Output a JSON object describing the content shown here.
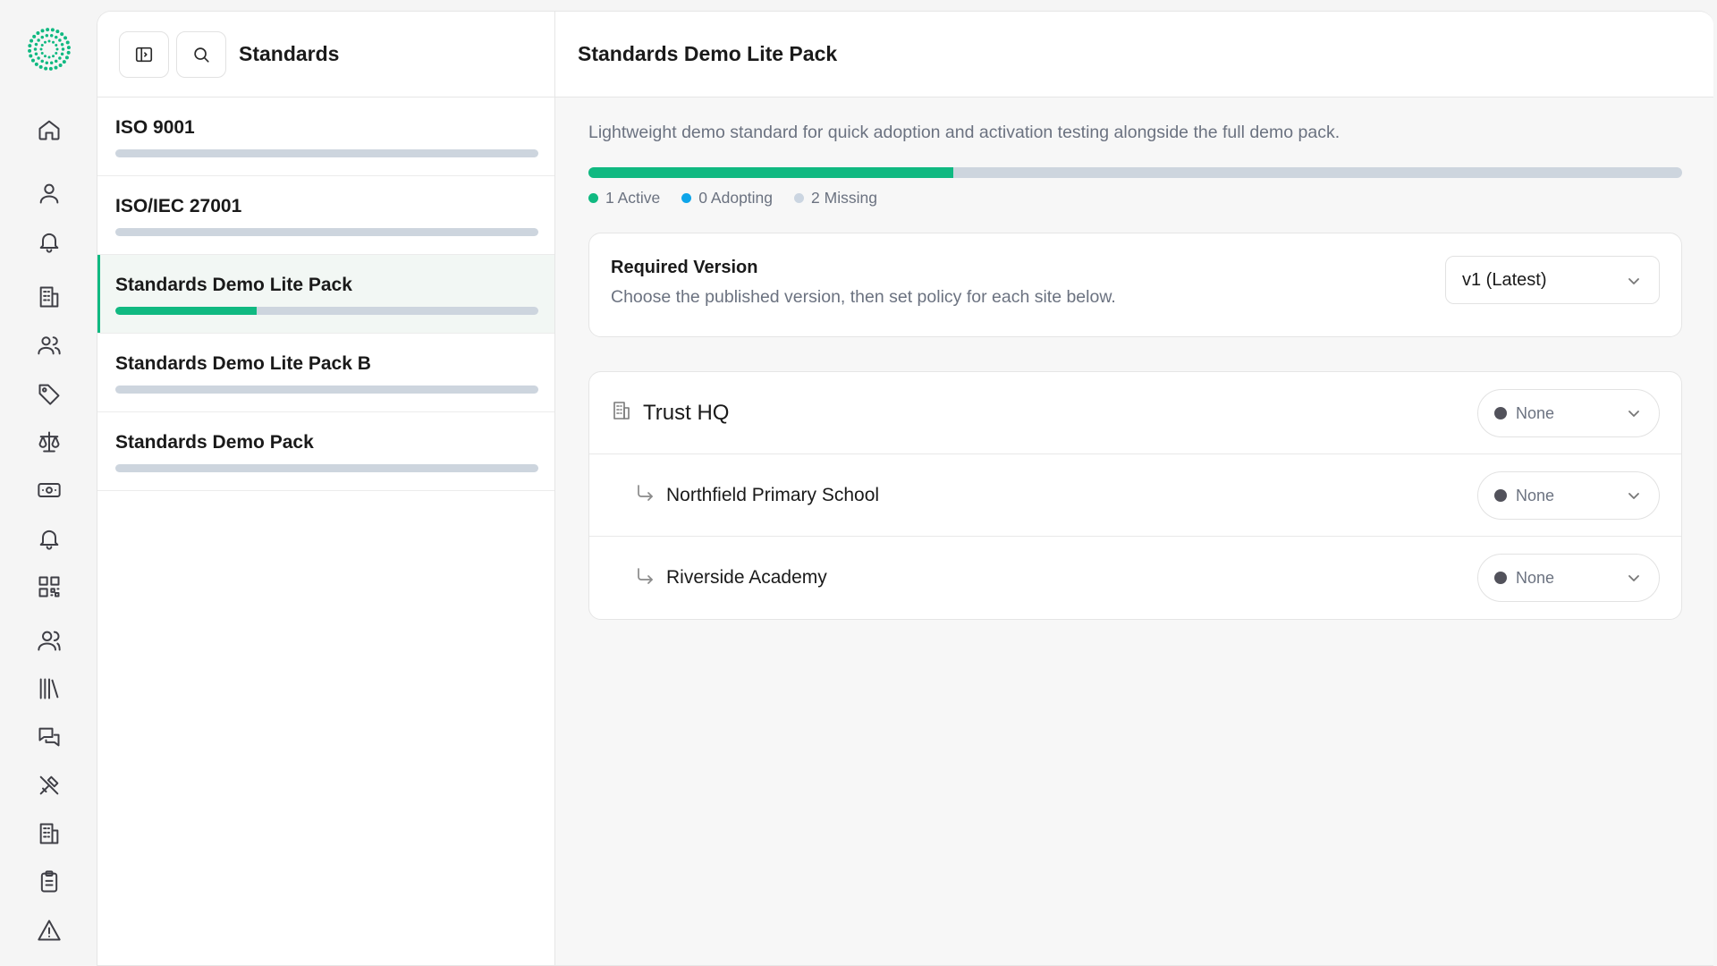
{
  "colors": {
    "accent": "#10b981",
    "adopting": "#0ea5e9",
    "missing": "#cbd5e1",
    "none_dot": "#52525b"
  },
  "rail": {
    "icons": [
      "home-icon",
      "user-icon",
      "bell-icon",
      "building-icon",
      "users-icon",
      "tag-icon",
      "scale-icon",
      "money-icon",
      "bell-icon",
      "qr-code-icon",
      "people-icon",
      "library-icon",
      "messages-icon",
      "tools-icon",
      "building-icon",
      "clipboard-icon",
      "warning-icon"
    ]
  },
  "list": {
    "title": "Standards",
    "items": [
      {
        "name": "ISO 9001",
        "progress": 0
      },
      {
        "name": "ISO/IEC 27001",
        "progress": 0
      },
      {
        "name": "Standards Demo Lite Pack",
        "progress": 0.333,
        "active": true
      },
      {
        "name": "Standards Demo Lite Pack B",
        "progress": 0
      },
      {
        "name": "Standards Demo Pack",
        "progress": 0
      }
    ]
  },
  "detail": {
    "title": "Standards Demo Lite Pack",
    "description": "Lightweight demo standard for quick adoption and activation testing alongside the full demo pack.",
    "progress": {
      "active": 1,
      "adopting": 0,
      "missing": 2
    },
    "legend": {
      "active": "1 Active",
      "adopting": "0 Adopting",
      "missing": "2 Missing"
    },
    "version": {
      "title": "Required Version",
      "subtitle": "Choose the published version, then set policy for each site below.",
      "selected": "v1 (Latest)"
    },
    "sites": [
      {
        "name": "Trust HQ",
        "policy": "None",
        "level": "parent"
      },
      {
        "name": "Northfield Primary School",
        "policy": "None",
        "level": "child"
      },
      {
        "name": "Riverside Academy",
        "policy": "None",
        "level": "child"
      }
    ]
  }
}
